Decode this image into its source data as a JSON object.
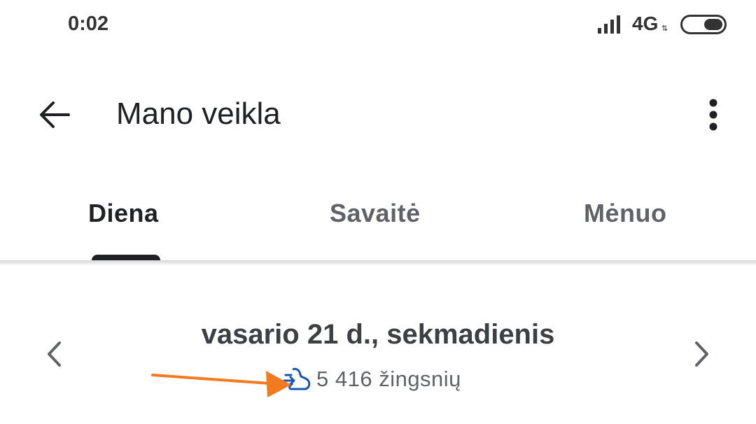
{
  "status_bar": {
    "time": "0:02",
    "network": "4G",
    "network_arrows": "⇅"
  },
  "app_bar": {
    "title": "Mano veikla"
  },
  "tabs": [
    {
      "label": "Diena",
      "active": true
    },
    {
      "label": "Savaitė",
      "active": false
    },
    {
      "label": "Mėnuo",
      "active": false
    }
  ],
  "date_nav": {
    "date": "vasario 21 d., sekmadienis",
    "steps": "5 416 žingsnių"
  },
  "colors": {
    "accent_blue": "#1a57b5",
    "annotation_orange": "#f47a20",
    "text_primary": "#202124",
    "text_secondary": "#5f6368"
  },
  "icons": [
    "back-arrow-icon",
    "more-vert-icon",
    "chevron-left-icon",
    "chevron-right-icon",
    "steps-shoe-icon",
    "signal-icon",
    "battery-icon"
  ]
}
